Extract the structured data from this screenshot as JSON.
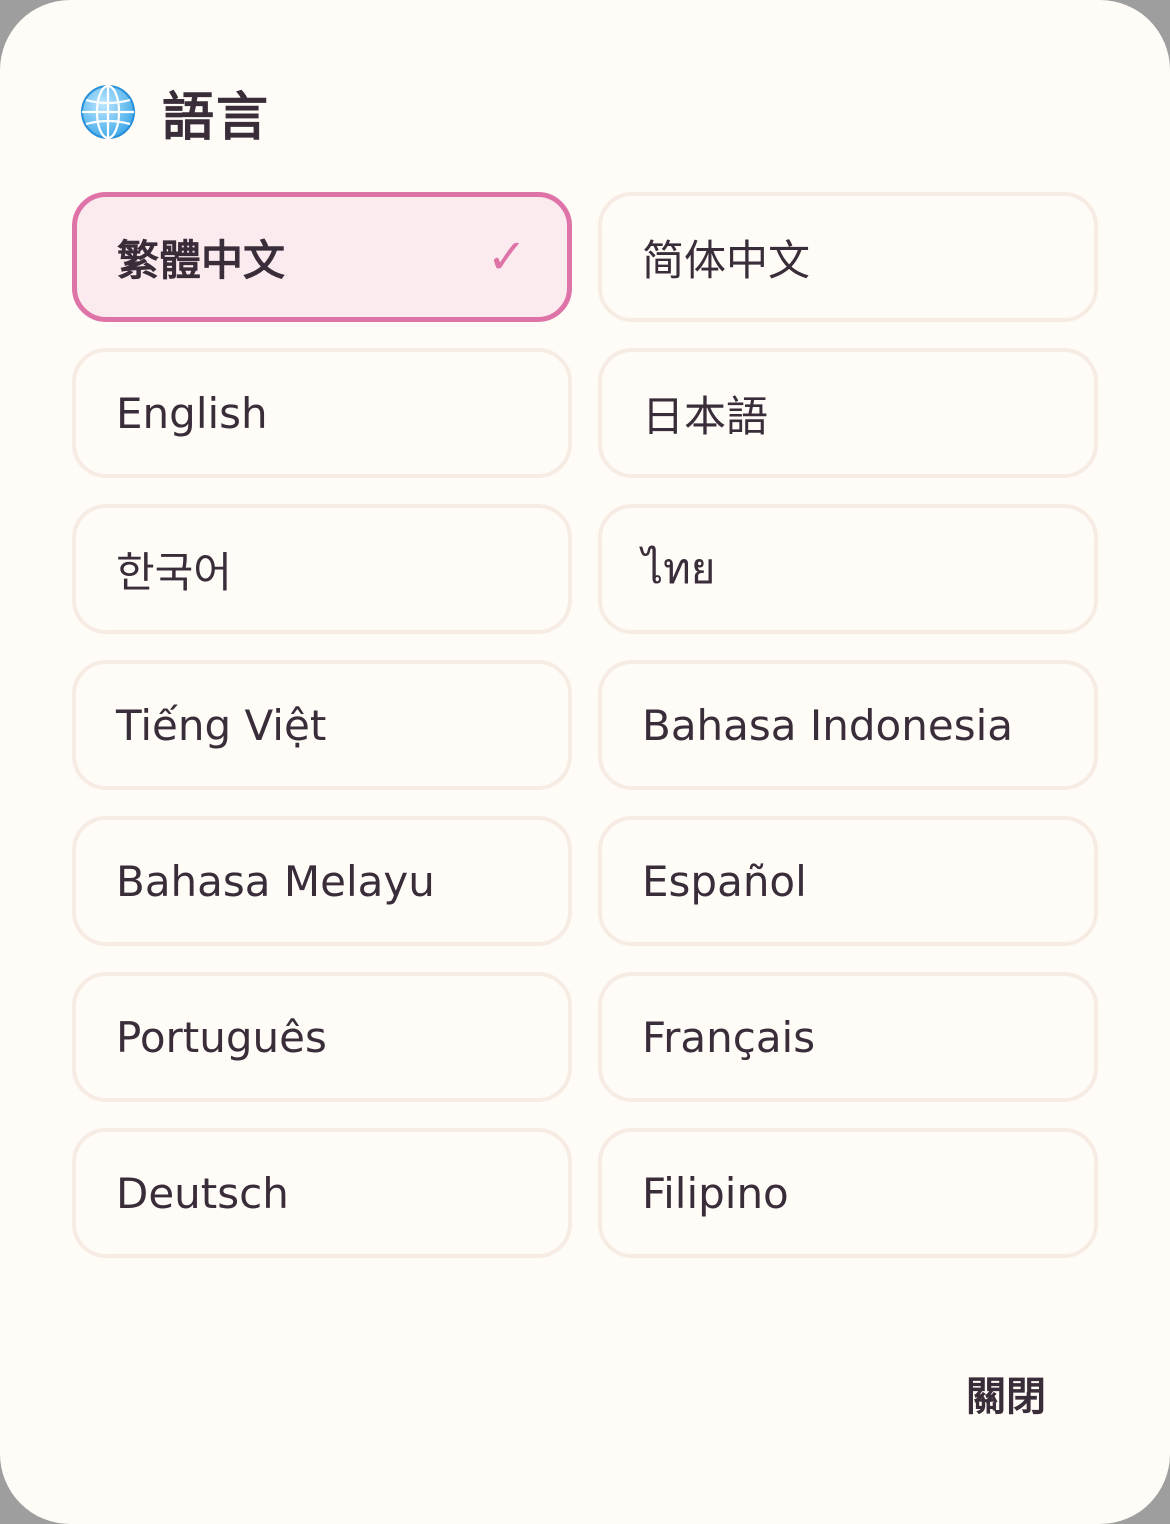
{
  "dialog": {
    "title": "語言",
    "icon": "globe-icon",
    "accent_color": "#de73a8",
    "close_label": "關閉"
  },
  "languages": [
    {
      "label": "繁體中文",
      "selected": true
    },
    {
      "label": "简体中文",
      "selected": false
    },
    {
      "label": "English",
      "selected": false
    },
    {
      "label": "日本語",
      "selected": false
    },
    {
      "label": "한국어",
      "selected": false
    },
    {
      "label": "ไทย",
      "selected": false
    },
    {
      "label": "Tiếng Việt",
      "selected": false
    },
    {
      "label": "Bahasa Indonesia",
      "selected": false
    },
    {
      "label": "Bahasa Melayu",
      "selected": false
    },
    {
      "label": "Español",
      "selected": false
    },
    {
      "label": "Português",
      "selected": false
    },
    {
      "label": "Français",
      "selected": false
    },
    {
      "label": "Deutsch",
      "selected": false
    },
    {
      "label": "Filipino",
      "selected": false
    }
  ],
  "selected_mark": "✓"
}
